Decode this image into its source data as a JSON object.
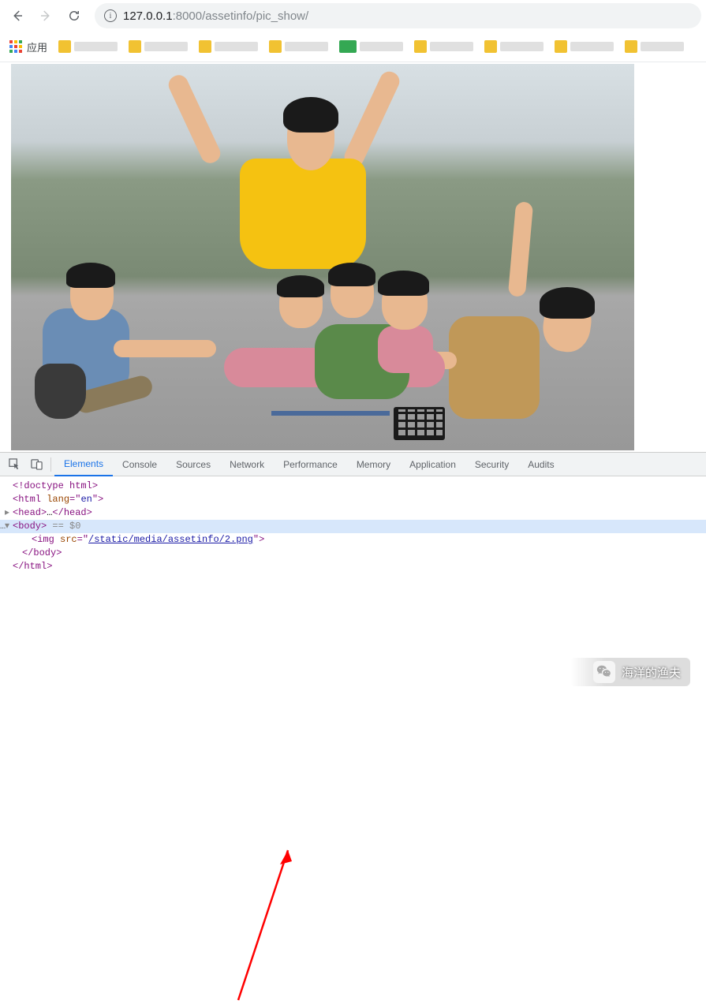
{
  "toolbar": {
    "url_host": "127.0.0.1",
    "url_port": ":8000",
    "url_path": "/assetinfo/pic_show/"
  },
  "bookmarks": {
    "apps_label": "应用"
  },
  "devtools": {
    "tabs": {
      "elements": "Elements",
      "console": "Console",
      "sources": "Sources",
      "network": "Network",
      "performance": "Performance",
      "memory": "Memory",
      "application": "Application",
      "security": "Security",
      "audits": "Audits"
    },
    "code": {
      "doctype": "<!doctype html>",
      "html_open_tag": "html",
      "html_lang_attr": "lang",
      "html_lang_val": "en",
      "head_tag": "head",
      "head_ellipsis": "…",
      "body_tag": "body",
      "eq0": " == $0",
      "img_tag": "img",
      "img_src_attr": "src",
      "img_src_val": "/static/media/assetinfo/2.png",
      "html_close_tag": "html"
    }
  },
  "watermark": {
    "text": "海洋的渔夫"
  }
}
